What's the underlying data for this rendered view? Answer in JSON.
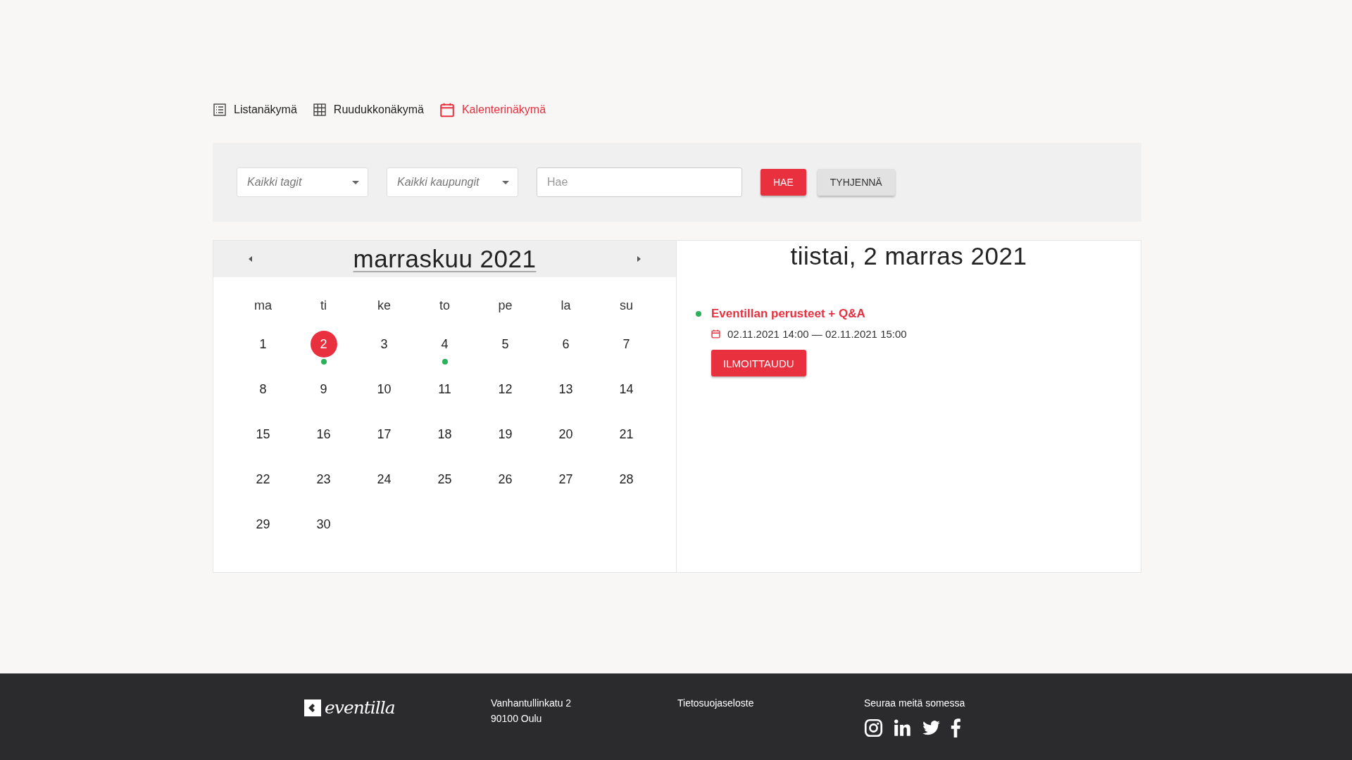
{
  "view_tabs": [
    {
      "label": "Listanäkymä",
      "kind": "list",
      "selected": false
    },
    {
      "label": "Ruudukkonäkymä",
      "kind": "grid",
      "selected": false
    },
    {
      "label": "Kalenterinäkymä",
      "kind": "calendar",
      "selected": true
    }
  ],
  "filters": {
    "tags_select": "Kaikki tagit",
    "city_select": "Kaikki kaupungit",
    "search": {
      "placeholder": "Hae"
    },
    "search_button": "HAE",
    "clear_button": "TYHJENNÄ"
  },
  "calendar": {
    "month_title": "marraskuu 2021",
    "weekdays": [
      "ma",
      "ti",
      "ke",
      "to",
      "pe",
      "la",
      "su"
    ],
    "days": [
      {
        "label": "1",
        "selected": false,
        "has_event": false
      },
      {
        "label": "2",
        "selected": true,
        "has_event": true
      },
      {
        "label": "3",
        "selected": false,
        "has_event": false
      },
      {
        "label": "4",
        "selected": false,
        "has_event": true
      },
      {
        "label": "5",
        "selected": false,
        "has_event": false
      },
      {
        "label": "6",
        "selected": false,
        "has_event": false
      },
      {
        "label": "7",
        "selected": false,
        "has_event": false
      },
      {
        "label": "8",
        "selected": false,
        "has_event": false
      },
      {
        "label": "9",
        "selected": false,
        "has_event": false
      },
      {
        "label": "10",
        "selected": false,
        "has_event": false
      },
      {
        "label": "11",
        "selected": false,
        "has_event": false
      },
      {
        "label": "12",
        "selected": false,
        "has_event": false
      },
      {
        "label": "13",
        "selected": false,
        "has_event": false
      },
      {
        "label": "14",
        "selected": false,
        "has_event": false
      },
      {
        "label": "15",
        "selected": false,
        "has_event": false
      },
      {
        "label": "16",
        "selected": false,
        "has_event": false
      },
      {
        "label": "17",
        "selected": false,
        "has_event": false
      },
      {
        "label": "18",
        "selected": false,
        "has_event": false
      },
      {
        "label": "19",
        "selected": false,
        "has_event": false
      },
      {
        "label": "20",
        "selected": false,
        "has_event": false
      },
      {
        "label": "21",
        "selected": false,
        "has_event": false
      },
      {
        "label": "22",
        "selected": false,
        "has_event": false
      },
      {
        "label": "23",
        "selected": false,
        "has_event": false
      },
      {
        "label": "24",
        "selected": false,
        "has_event": false
      },
      {
        "label": "25",
        "selected": false,
        "has_event": false
      },
      {
        "label": "26",
        "selected": false,
        "has_event": false
      },
      {
        "label": "27",
        "selected": false,
        "has_event": false
      },
      {
        "label": "28",
        "selected": false,
        "has_event": false
      },
      {
        "label": "29",
        "selected": false,
        "has_event": false
      },
      {
        "label": "30",
        "selected": false,
        "has_event": false
      }
    ]
  },
  "day_panel": {
    "title": "tiistai, 2 marras 2021",
    "events": [
      {
        "title": "Eventillan perusteet + Q&A",
        "time": "02.11.2021 14:00 — 02.11.2021 15:00",
        "button": "ILMOITTAUDU"
      }
    ]
  },
  "footer": {
    "logo": "eventilla",
    "address": [
      "Vanhantullinkatu 2",
      "90100 Oulu"
    ],
    "privacy_link": "Tietosuojaseloste",
    "social_heading": "Seuraa meitä somessa",
    "social": [
      {
        "kind": "instagram"
      },
      {
        "kind": "linkedin"
      },
      {
        "kind": "twitter"
      },
      {
        "kind": "facebook"
      }
    ]
  }
}
